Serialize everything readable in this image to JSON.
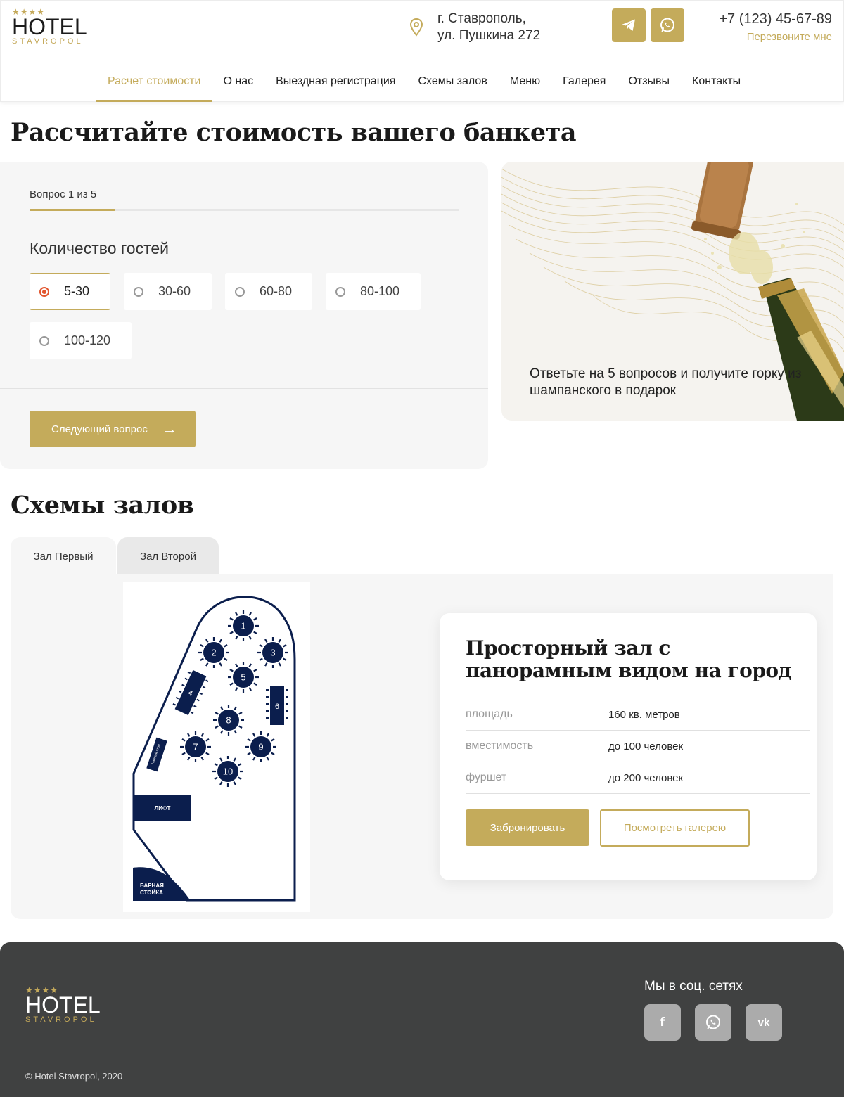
{
  "brand": {
    "stars": "★★★★",
    "name": "HOTEL",
    "sub": "STAVROPOL",
    "accent": "#c4ab5b"
  },
  "header": {
    "address_line1": "г. Ставрополь,",
    "address_line2": "ул. Пушкина 272",
    "phone": "+7 (123) 45-67-89",
    "callback": "Перезвоните мне",
    "socials": [
      "telegram-icon",
      "whatsapp-icon"
    ]
  },
  "nav": [
    {
      "label": "Расчет стоимости",
      "active": true
    },
    {
      "label": "О нас"
    },
    {
      "label": "Выездная регистрация"
    },
    {
      "label": "Схемы залов"
    },
    {
      "label": "Меню"
    },
    {
      "label": "Галерея"
    },
    {
      "label": "Отзывы"
    },
    {
      "label": "Контакты"
    }
  ],
  "calc": {
    "title": "Рассчитайте стоимость вашего банкета",
    "question_counter": "Вопрос 1 из 5",
    "progress": 0.2,
    "question": "Количество гостей",
    "options": [
      "5-30",
      "30-60",
      "60-80",
      "80-100",
      "100-120"
    ],
    "selected": "5-30",
    "next_label": "Следующий вопрос",
    "next_arrow": "→",
    "promo_text": "Ответьте на 5 вопросов и получите горку из шампанского в подарок"
  },
  "halls": {
    "title": "Схемы залов",
    "tabs": [
      "Зал Первый",
      "Зал Второй"
    ],
    "active_tab": "Зал Первый",
    "plan": {
      "tables": [
        "1",
        "2",
        "3",
        "4",
        "5",
        "6",
        "7",
        "8",
        "9",
        "10"
      ],
      "tea_table": "Чайный стол",
      "lift": "ЛИФТ",
      "bar_line1": "БАРНАЯ",
      "bar_line2": "СТОЙКА"
    },
    "card": {
      "title": "Просторный зал с панорамным видом на город",
      "rows": [
        {
          "key": "площадь",
          "value": "160 кв. метров"
        },
        {
          "key": "вместимость",
          "value": "до 100 человек"
        },
        {
          "key": "фуршет",
          "value": "до 200 человек"
        }
      ],
      "book_label": "Забронировать",
      "gallery_label": "Посмотреть галерею"
    }
  },
  "footer": {
    "social_title": "Мы в соц. сетях",
    "socials": [
      {
        "icon": "facebook-icon",
        "glyph": "f"
      },
      {
        "icon": "whatsapp-icon",
        "glyph": ""
      },
      {
        "icon": "vk-icon",
        "glyph": "vk"
      }
    ],
    "copyright": "© Hotel Stavropol, 2020"
  }
}
